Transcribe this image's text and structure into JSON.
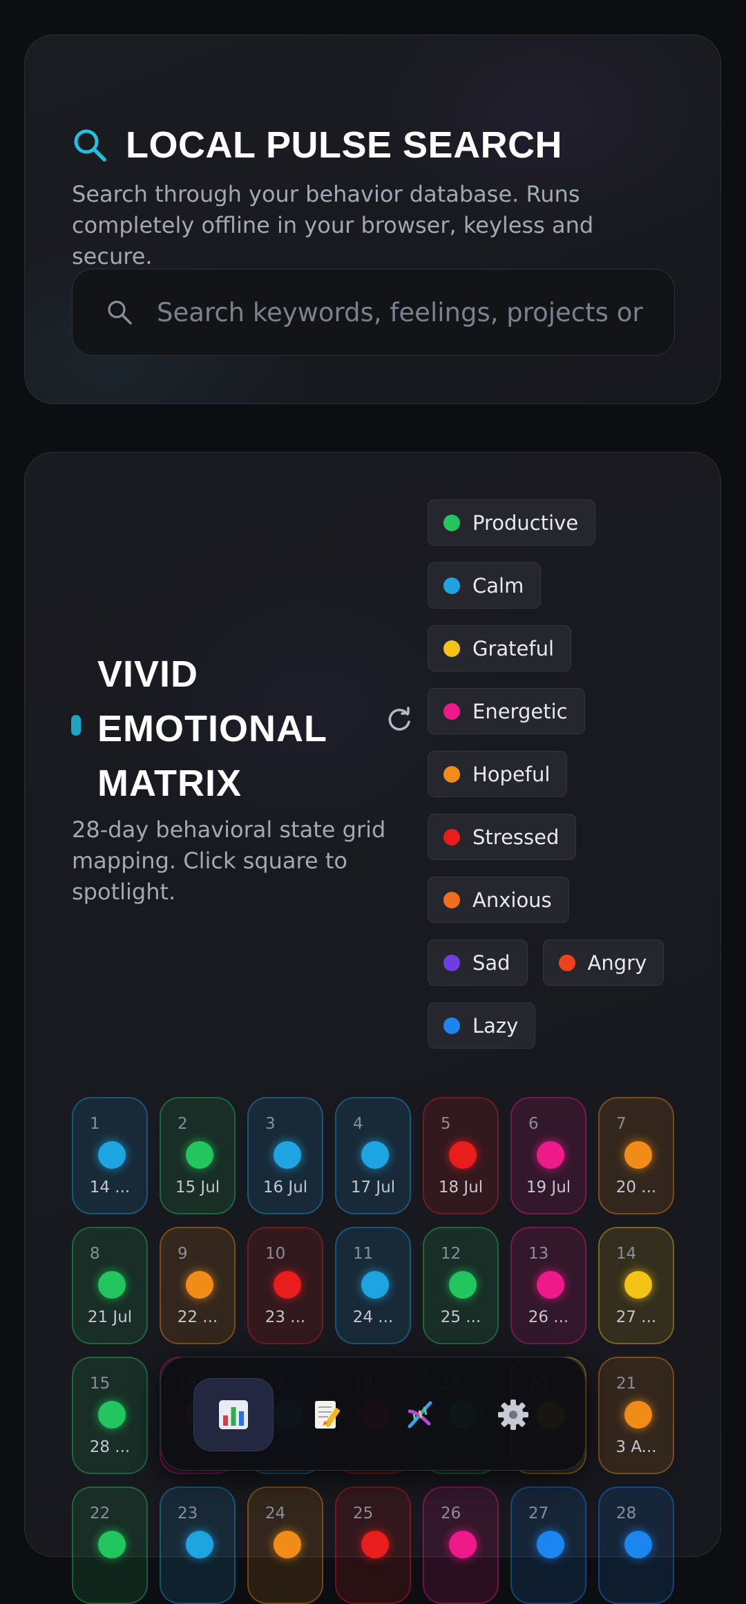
{
  "search": {
    "title": "LOCAL PULSE SEARCH",
    "description": "Search through your behavior database. Runs completely offline in your browser, keyless and secure.",
    "placeholder": "Search keywords, feelings, projects or dates...",
    "value": ""
  },
  "matrix": {
    "title": "VIVID EMOTIONAL MATRIX",
    "description": "28-day behavioral state grid mapping. Click square to spotlight.",
    "legend": [
      {
        "label": "Productive",
        "color": "#22c55e"
      },
      {
        "label": "Calm",
        "color": "#1ea4e0"
      },
      {
        "label": "Grateful",
        "color": "#f3c315"
      },
      {
        "label": "Energetic",
        "color": "#ef1a8a"
      },
      {
        "label": "Hopeful",
        "color": "#f28c18"
      },
      {
        "label": "Stressed",
        "color": "#ea1d1d"
      },
      {
        "label": "Anxious",
        "color": "#f26e1c"
      },
      {
        "label": "Sad",
        "color": "#6f3ee3"
      },
      {
        "label": "Angry",
        "color": "#f0421a"
      },
      {
        "label": "Lazy",
        "color": "#1b86f0"
      }
    ],
    "cells": [
      {
        "num": "1",
        "date": "14 ...",
        "mood": "Calm"
      },
      {
        "num": "2",
        "date": "15 Jul",
        "mood": "Productive"
      },
      {
        "num": "3",
        "date": "16 Jul",
        "mood": "Calm"
      },
      {
        "num": "4",
        "date": "17 Jul",
        "mood": "Calm"
      },
      {
        "num": "5",
        "date": "18 Jul",
        "mood": "Stressed"
      },
      {
        "num": "6",
        "date": "19 Jul",
        "mood": "Energetic"
      },
      {
        "num": "7",
        "date": "20 ...",
        "mood": "Hopeful"
      },
      {
        "num": "8",
        "date": "21 Jul",
        "mood": "Productive"
      },
      {
        "num": "9",
        "date": "22 ...",
        "mood": "Hopeful"
      },
      {
        "num": "10",
        "date": "23 ...",
        "mood": "Stressed"
      },
      {
        "num": "11",
        "date": "24 ...",
        "mood": "Calm"
      },
      {
        "num": "12",
        "date": "25 ...",
        "mood": "Productive"
      },
      {
        "num": "13",
        "date": "26 ...",
        "mood": "Energetic"
      },
      {
        "num": "14",
        "date": "27 ...",
        "mood": "Grateful"
      },
      {
        "num": "15",
        "date": "28 ...",
        "mood": "Productive"
      },
      {
        "num": "16",
        "date": "",
        "mood": "Energetic"
      },
      {
        "num": "17",
        "date": "",
        "mood": "Calm"
      },
      {
        "num": "18",
        "date": "",
        "mood": "Stressed"
      },
      {
        "num": "19",
        "date": "",
        "mood": "Productive"
      },
      {
        "num": "20",
        "date": "",
        "mood": "Grateful"
      },
      {
        "num": "21",
        "date": "3 A...",
        "mood": "Hopeful"
      },
      {
        "num": "22",
        "date": "",
        "mood": "Productive"
      },
      {
        "num": "23",
        "date": "",
        "mood": "Calm"
      },
      {
        "num": "24",
        "date": "",
        "mood": "Hopeful"
      },
      {
        "num": "25",
        "date": "",
        "mood": "Stressed"
      },
      {
        "num": "26",
        "date": "",
        "mood": "Energetic"
      },
      {
        "num": "27",
        "date": "",
        "mood": "Lazy"
      },
      {
        "num": "28",
        "date": "",
        "mood": "Lazy"
      }
    ]
  },
  "dock": {
    "items": [
      {
        "name": "dashboard",
        "icon": "bar-chart-icon",
        "active": true
      },
      {
        "name": "journal",
        "icon": "memo-icon",
        "active": false
      },
      {
        "name": "dna",
        "icon": "dna-icon",
        "active": false
      },
      {
        "name": "settings",
        "icon": "gear-icon",
        "active": false
      }
    ]
  }
}
